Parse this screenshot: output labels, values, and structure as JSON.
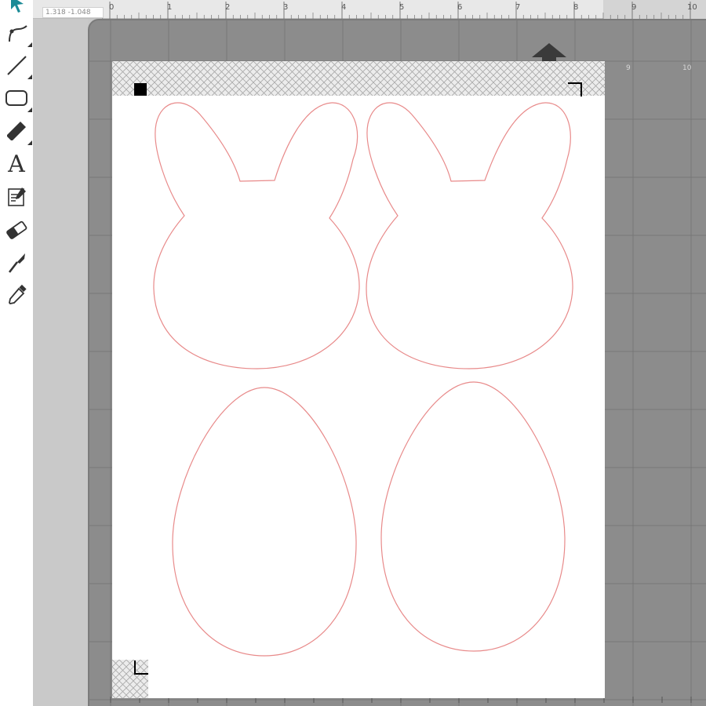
{
  "toolbar": {
    "tools": [
      {
        "name": "select-tool",
        "icon": "select-arrow-icon"
      },
      {
        "name": "bezier-tool",
        "icon": "bezier-pen-icon"
      },
      {
        "name": "line-tool",
        "icon": "line-icon"
      },
      {
        "name": "shape-tool",
        "icon": "rounded-rectangle-icon"
      },
      {
        "name": "draw-tool",
        "icon": "pencil-icon"
      },
      {
        "name": "text-tool",
        "icon": "text-icon",
        "glyph": "A"
      },
      {
        "name": "sketch-tool",
        "icon": "sketch-icon"
      },
      {
        "name": "eraser-tool",
        "icon": "eraser-icon"
      },
      {
        "name": "knife-tool",
        "icon": "knife-icon"
      },
      {
        "name": "eyedropper-tool",
        "icon": "eyedropper-icon"
      }
    ],
    "accent_color": "#1a8a96"
  },
  "ruler": {
    "coord_readout": "1.318  -1.048",
    "labels": [
      "0",
      "1",
      "2",
      "3",
      "4",
      "5",
      "6",
      "7",
      "8",
      "9",
      "10"
    ]
  },
  "mat": {
    "feed_arrow_icon": "up-arrow-icon",
    "grid_labels": [
      "9",
      "10"
    ],
    "color": "#8c8c8c"
  },
  "paper": {
    "registration_marks": [
      "square-mark",
      "top-right-corner-mark",
      "bottom-left-corner-mark"
    ],
    "shapes": [
      "bunny-left",
      "bunny-right",
      "egg-left",
      "egg-right"
    ],
    "cut_line_color": "#e88a8a"
  }
}
